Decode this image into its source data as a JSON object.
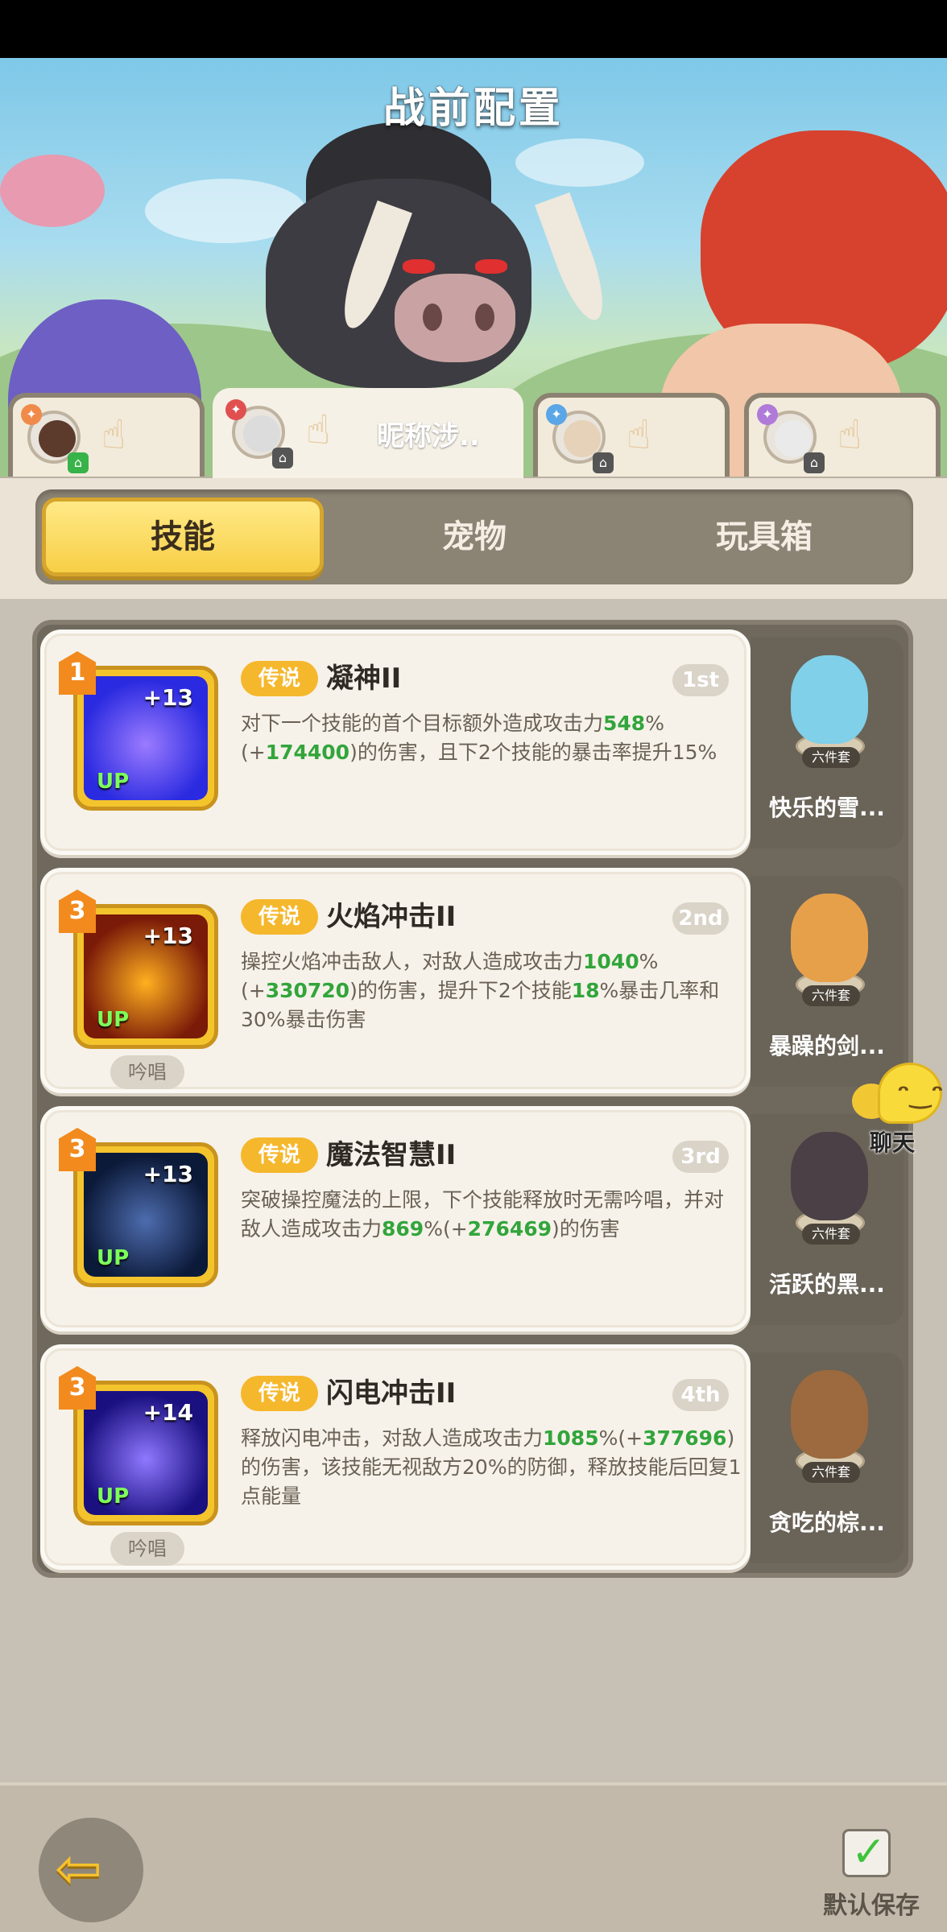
{
  "page": {
    "title": "战前配置"
  },
  "heroes": [
    {
      "name": "",
      "badge_color": "#f08a4a",
      "corner": "⌂",
      "corner_green": true,
      "face_color": "#5d3b2c"
    },
    {
      "name": "昵称涉..",
      "badge_color": "#e05050",
      "corner": "⌂",
      "corner_green": false,
      "face_color": "#dcdcdc"
    },
    {
      "name": "",
      "badge_color": "#5aa6e6",
      "corner": "⌂",
      "corner_green": false,
      "face_color": "#e6d2b8"
    },
    {
      "name": "",
      "badge_color": "#b07ad8",
      "corner": "⌂",
      "corner_green": false,
      "face_color": "#eaeaea"
    }
  ],
  "tabs": [
    {
      "label": "技能",
      "active": true
    },
    {
      "label": "宠物",
      "active": false
    },
    {
      "label": "玩具箱",
      "active": false
    }
  ],
  "skills": [
    {
      "level": "1",
      "plus": "+13",
      "up": "UP",
      "chant": "",
      "rarity": "传说",
      "name": "凝神II",
      "rank": "1st",
      "desc_parts": [
        "对下一个技能的首个目标额外造成攻击力",
        "548",
        "%(+",
        "174400",
        ")的伤害，且下2个技能的暴击率提升15%"
      ],
      "art": [
        "#2a2ae0",
        "#9b7bff"
      ],
      "pet": {
        "tag": "六件套",
        "name": "快乐的雪...",
        "color": "#7fd0e8"
      }
    },
    {
      "level": "3",
      "plus": "+13",
      "up": "UP",
      "chant": "吟唱",
      "rarity": "传说",
      "name": "火焰冲击II",
      "rank": "2nd",
      "desc_parts": [
        "操控火焰冲击敌人，对敌人造成攻击力",
        "1040",
        "%(+",
        "330720",
        ")的伤害，提升下2个技能",
        "18",
        "%暴击几率和30%暴击伤害"
      ],
      "art": [
        "#7a1a08",
        "#ffb020"
      ],
      "pet": {
        "tag": "六件套",
        "name": "暴躁的剑...",
        "color": "#e7a04a"
      }
    },
    {
      "level": "3",
      "plus": "+13",
      "up": "UP",
      "chant": "",
      "rarity": "传说",
      "name": "魔法智慧II",
      "rank": "3rd",
      "desc_parts": [
        "突破操控魔法的上限，下个技能释放时无需吟唱，并对敌人造成攻击力",
        "869",
        "%(+",
        "276469",
        ")的伤害"
      ],
      "art": [
        "#0c1a3a",
        "#4d6cae"
      ],
      "pet": {
        "tag": "六件套",
        "name": "活跃的黑...",
        "color": "#4a4045"
      }
    },
    {
      "level": "3",
      "plus": "+14",
      "up": "UP",
      "chant": "吟唱",
      "rarity": "传说",
      "name": "闪电冲击II",
      "rank": "4th",
      "desc_parts": [
        "释放闪电冲击，对敌人造成攻击力",
        "1085",
        "%(+",
        "377696",
        ")的伤害，该技能无视敌方20%的防御，释放技能后回复1点能量"
      ],
      "art": [
        "#1a1080",
        "#8f78ff"
      ],
      "pet": {
        "tag": "六件套",
        "name": "贪吃的棕...",
        "color": "#9c6a3e"
      }
    }
  ],
  "chat": {
    "label": "聊天"
  },
  "footer": {
    "save_label": "默认保存"
  }
}
